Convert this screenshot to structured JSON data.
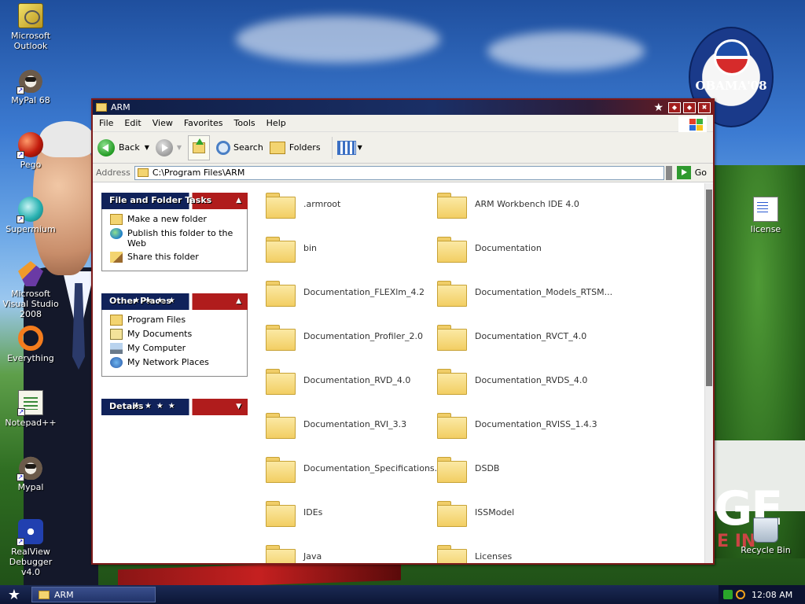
{
  "desktop": {
    "icons": [
      {
        "label": "Microsoft Outlook"
      },
      {
        "label": "MyPal 68"
      },
      {
        "label": "Pego"
      },
      {
        "label": "Supermium"
      },
      {
        "label": "Microsoft Visual Studio 2008"
      },
      {
        "label": "Everything"
      },
      {
        "label": "Notepad++"
      },
      {
        "label": "Mypal"
      },
      {
        "label": "RealView Debugger v4.0"
      },
      {
        "label": "license"
      },
      {
        "label": "Recycle Bin"
      }
    ],
    "badge_text": "OBAMA'08",
    "wallpaper_big_text": "GE",
    "wallpaper_sub_text": "E IN"
  },
  "window": {
    "title": "ARM",
    "menu": [
      "File",
      "Edit",
      "View",
      "Favorites",
      "Tools",
      "Help"
    ],
    "toolbar": {
      "back": "Back",
      "search": "Search",
      "folders": "Folders"
    },
    "address": {
      "label": "Address",
      "value": "C:\\Program Files\\ARM",
      "go": "Go"
    },
    "panels": {
      "file_tasks": {
        "title": "File and Folder Tasks",
        "items": [
          "Make a new folder",
          "Publish this folder to the Web",
          "Share this folder"
        ]
      },
      "other_places": {
        "title": "Other Places",
        "items": [
          "Program Files",
          "My Documents",
          "My Computer",
          "My Network Places"
        ]
      },
      "details": {
        "title": "Details"
      }
    },
    "folders": [
      ".armroot",
      "ARM Workbench IDE 4.0",
      "bin",
      "Documentation",
      "Documentation_FLEXlm_4.2",
      "Documentation_Models_RTSM...",
      "Documentation_Profiler_2.0",
      "Documentation_RVCT_4.0",
      "Documentation_RVD_4.0",
      "Documentation_RVDS_4.0",
      "Documentation_RVI_3.3",
      "Documentation_RVISS_1.4.3",
      "Documentation_Specifications...",
      "DSDB",
      "IDEs",
      "ISSModel",
      "Java",
      "Licenses"
    ]
  },
  "taskbar": {
    "task": "ARM",
    "clock": "12:08 AM"
  },
  "colors": {
    "accent_red": "#b01c1c",
    "navy": "#10225a",
    "folder": "#f2ce63"
  }
}
